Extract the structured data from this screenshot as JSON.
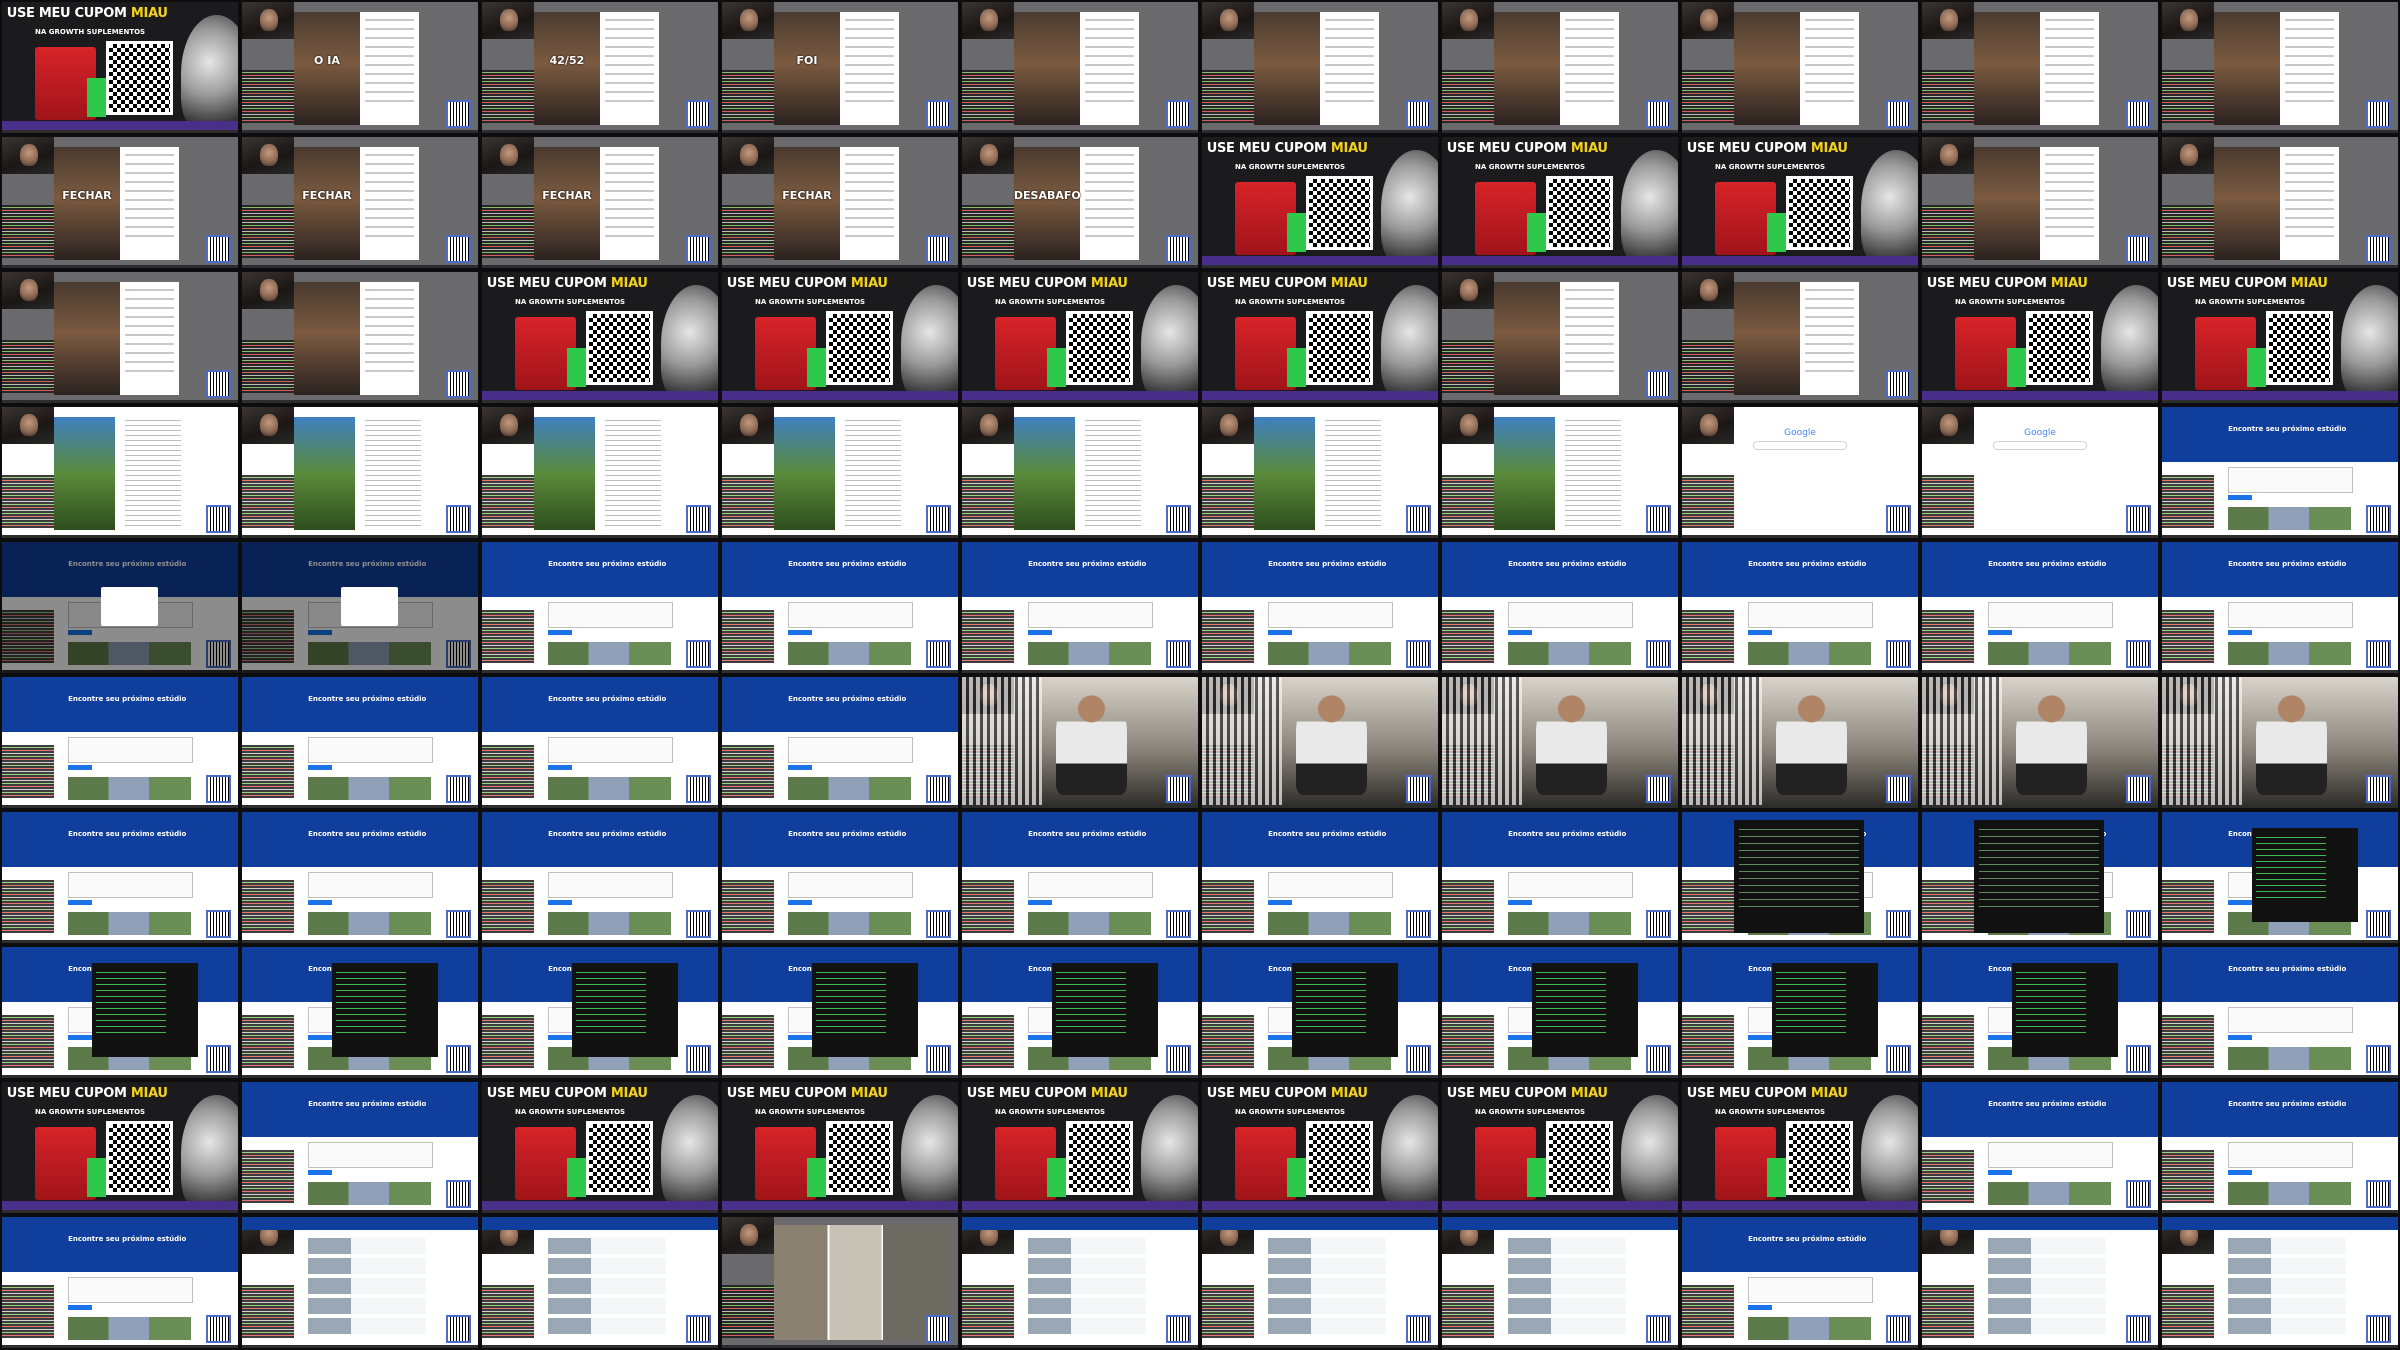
{
  "ad": {
    "line1": "USE MEU CUPOM",
    "code": "MIAU",
    "line2": "NA GROWTH SUPLEMENTOS"
  },
  "site": {
    "headline": "Encontre seu próximo estúdio"
  },
  "google": {
    "logo": "Google"
  },
  "captions": {
    "oia": "O IA",
    "timer": "42/52",
    "foi": "FOI",
    "fechar": "FECHAR",
    "desabafo": "DESABAFO"
  },
  "rows": [
    [
      "ad",
      "reel:oia",
      "reel:timer",
      "reel:foi",
      "reel",
      "reel",
      "reel",
      "reel",
      "reel",
      "reel"
    ],
    [
      "reel:fechar",
      "reel:fechar",
      "reel:fechar",
      "reel:fechar",
      "reel:desabafo",
      "ad",
      "ad",
      "ad",
      "reel",
      "reel"
    ],
    [
      "reel",
      "reel",
      "ad",
      "ad",
      "ad",
      "ad",
      "reel",
      "reel",
      "ad",
      "ad"
    ],
    [
      "article",
      "article",
      "article",
      "article",
      "article",
      "article",
      "article",
      "google",
      "google",
      "site"
    ],
    [
      "dim",
      "dim",
      "site",
      "site",
      "site",
      "site",
      "site",
      "site",
      "site",
      "site"
    ],
    [
      "site",
      "site",
      "site",
      "site",
      "gym",
      "gym",
      "gym",
      "gym",
      "gym",
      "gym"
    ],
    [
      "site",
      "site",
      "site",
      "site",
      "site",
      "site",
      "site",
      "dark",
      "dark",
      "overlay"
    ],
    [
      "overlay",
      "overlay",
      "overlay",
      "overlay",
      "overlay",
      "overlay",
      "overlay",
      "overlay",
      "overlay",
      "site"
    ],
    [
      "ad",
      "site",
      "ad",
      "ad",
      "ad",
      "ad",
      "ad",
      "ad",
      "site",
      "site"
    ],
    [
      "site",
      "listing",
      "listing",
      "photos",
      "listing",
      "listing",
      "listing",
      "site",
      "listing",
      "listing"
    ]
  ]
}
